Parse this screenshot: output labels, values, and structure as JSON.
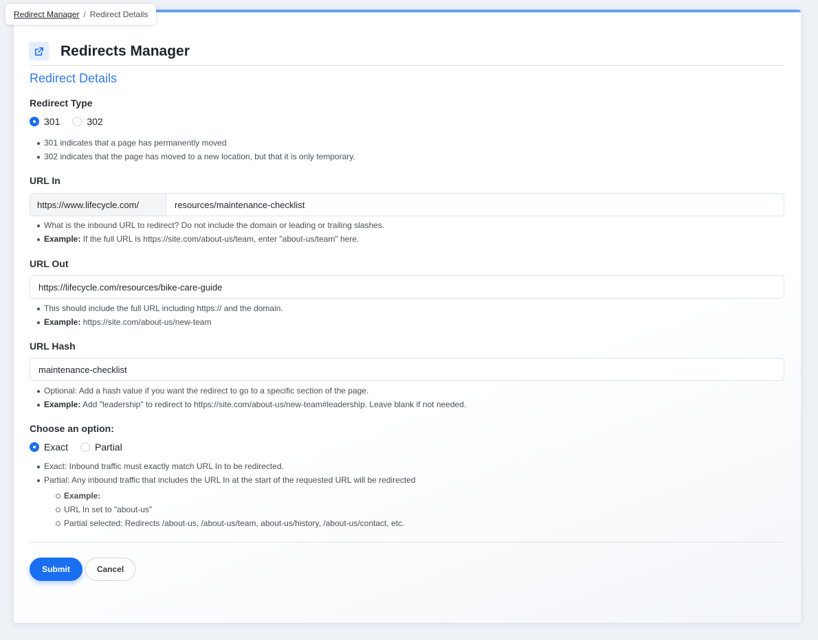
{
  "breadcrumb": {
    "parent": "Redirect Manager",
    "separator": "/",
    "current": "Redirect Details"
  },
  "header": {
    "icon": "external-link-icon",
    "title": "Redirects Manager"
  },
  "colors": {
    "accent": "#1a6ef0",
    "section_title": "#2f7be6",
    "top_border": "#64a0f0"
  },
  "form": {
    "section_title": "Redirect Details",
    "redirect_type": {
      "label": "Redirect Type",
      "options": [
        "301",
        "302"
      ],
      "selected": "301",
      "help": [
        "301 indicates that a page has permanently moved",
        "302 indicates that the page has moved to a new location, but that it is only temporary."
      ]
    },
    "url_in": {
      "label": "URL In",
      "prefix": "https://www.lifecycle.com/",
      "value": "resources/maintenance-checklist",
      "help": "What is the inbound URL to redirect? Do not include the domain or leading or trailing slashes.",
      "example_label": "Example:",
      "example_text": "If the full URL is https://site.com/about-us/team, enter \"about-us/team\" here."
    },
    "url_out": {
      "label": "URL Out",
      "value": "https://lifecycle.com/resources/bike-care-guide",
      "help": "This should include the full URL including https:// and the domain.",
      "example_label": "Example:",
      "example_text": "https://site.com/about-us/new-team"
    },
    "url_hash": {
      "label": "URL Hash",
      "value": "maintenance-checklist",
      "help": "Optional: Add a hash value if you want the redirect to go to a specific section of the page.",
      "example_label": "Example:",
      "example_text": "Add \"leadership\" to redirect to https://site.com/about-us/new-team#leadership. Leave blank if not needed."
    },
    "match_option": {
      "label": "Choose an option:",
      "options": [
        "Exact",
        "Partial"
      ],
      "selected": "Exact",
      "help": [
        "Exact: Inbound traffic must exactly match URL In to be redirected.",
        "Partial: Any inbound traffic that includes the URL In at the start of the requested URL will be redirected"
      ],
      "sub_example_label": "Example:",
      "sub_items": [
        "URL In set to \"about-us\"",
        "Partial selected: Redirects /about-us, /about-us/team, about-us/history, /about-us/contact, etc."
      ]
    },
    "buttons": {
      "submit": "Submit",
      "cancel": "Cancel"
    }
  }
}
